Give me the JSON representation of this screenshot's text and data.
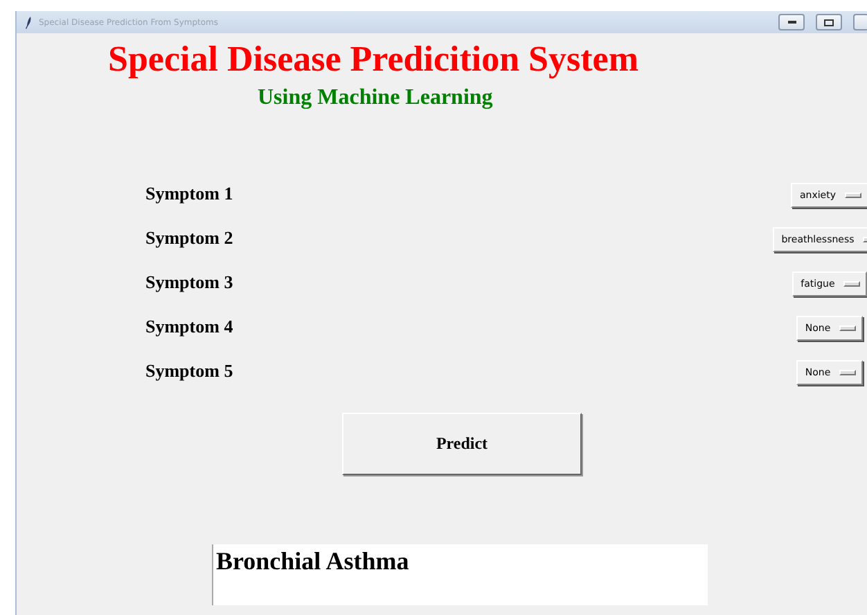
{
  "window": {
    "title": "Special Disease Prediction From Symptoms"
  },
  "heading": "Special Disease Predicition System",
  "subheading": "Using Machine Learning",
  "symptoms": [
    {
      "label": "Symptom 1",
      "value": "anxiety"
    },
    {
      "label": "Symptom 2",
      "value": "breathlessness"
    },
    {
      "label": "Symptom 3",
      "value": "fatigue"
    },
    {
      "label": "Symptom 4",
      "value": "None"
    },
    {
      "label": "Symptom 5",
      "value": "None"
    }
  ],
  "predict_button": "Predict",
  "result": "Bronchial Asthma"
}
